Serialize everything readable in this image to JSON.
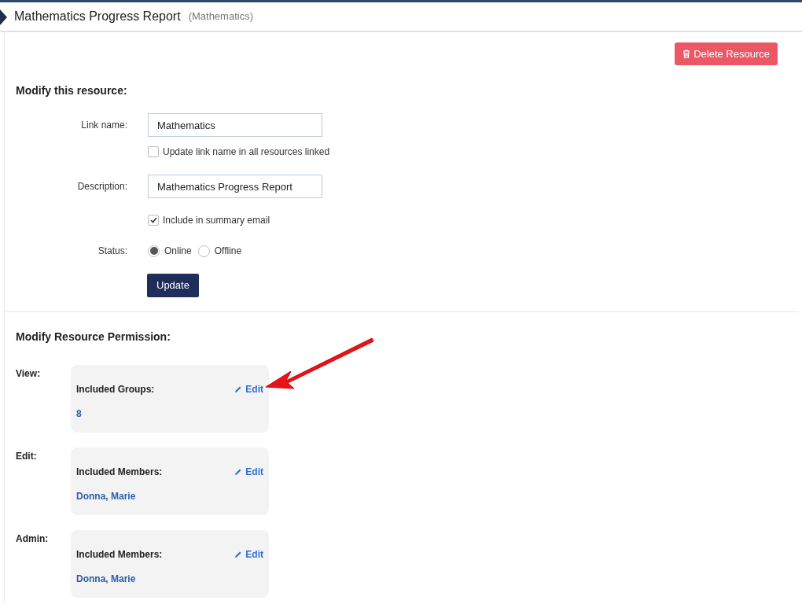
{
  "header": {
    "title": "Mathematics Progress Report",
    "subtitle": "(Mathematics)"
  },
  "delete_button": "Delete Resource",
  "resource_form": {
    "heading": "Modify this resource:",
    "link_name": {
      "label": "Link name:",
      "value": "Mathematics"
    },
    "update_all_checkbox": {
      "label": "Update link name in all resources linked",
      "checked": false
    },
    "description": {
      "label": "Description:",
      "value": "Mathematics Progress Report"
    },
    "summary_email_checkbox": {
      "label": "Include in summary email",
      "checked": true
    },
    "status": {
      "label": "Status:",
      "options": [
        {
          "label": "Online",
          "selected": true
        },
        {
          "label": "Offline",
          "selected": false
        }
      ]
    },
    "update_button": "Update"
  },
  "permissions": {
    "heading": "Modify Resource Permission:",
    "sections": [
      {
        "label": "View:",
        "card_title": "Included Groups:",
        "edit_link": "Edit",
        "value": "8"
      },
      {
        "label": "Edit:",
        "card_title": "Included Members:",
        "edit_link": "Edit",
        "value": "Donna, Marie"
      },
      {
        "label": "Admin:",
        "card_title": "Included Members:",
        "edit_link": "Edit",
        "value": "Donna, Marie"
      }
    ]
  }
}
